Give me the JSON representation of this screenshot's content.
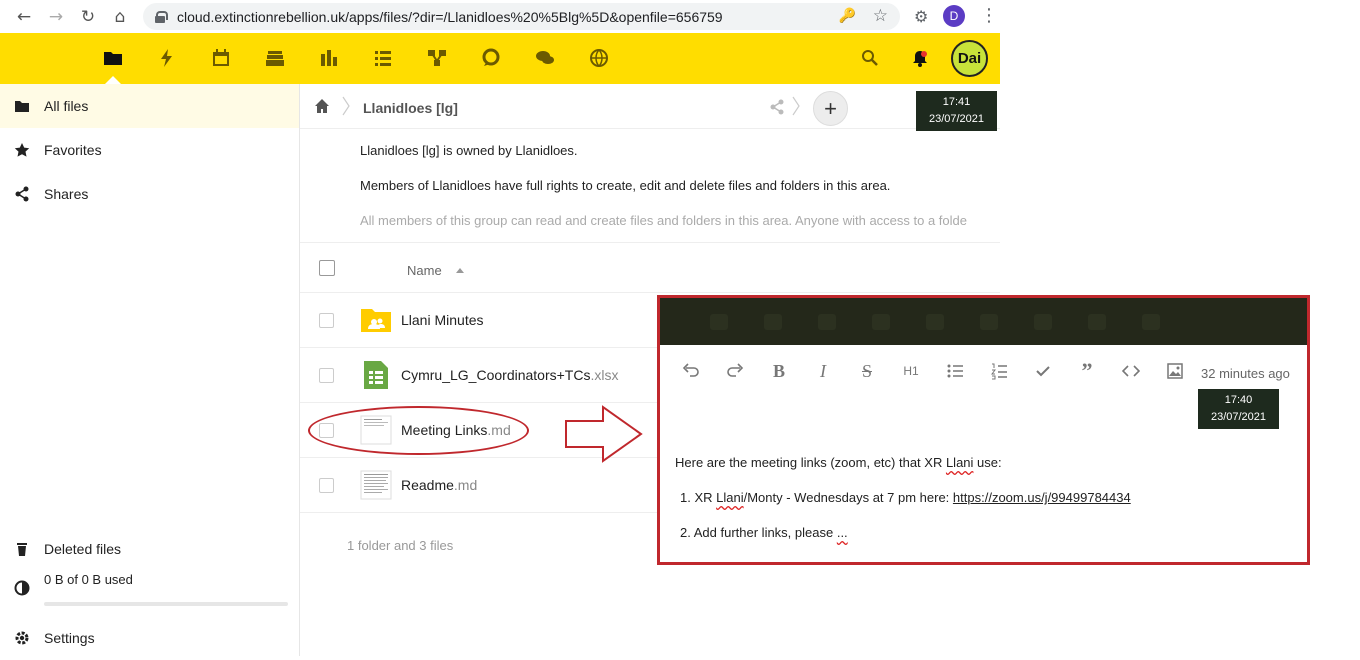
{
  "browser": {
    "url": "cloud.extinctionrebellion.uk/apps/files/?dir=/Llanidloes%20%5Blg%5D&openfile=656759",
    "profile_initial": "D"
  },
  "header": {
    "apps": [
      "files-icon",
      "activity-icon",
      "calendar-icon",
      "deck-icon",
      "analytics-icon",
      "tasks-icon",
      "circles-icon",
      "talk-icon",
      "chat-icon",
      "globe-icon"
    ],
    "avatar_text": "Dai",
    "accent": "#ffdd00"
  },
  "clock_top": {
    "time": "17:41",
    "date": "23/07/2021"
  },
  "sidebar": {
    "items": [
      {
        "label": "All files"
      },
      {
        "label": "Favorites"
      },
      {
        "label": "Shares"
      }
    ],
    "deleted_label": "Deleted files",
    "quota_label": "0 B of 0 B used",
    "settings_label": "Settings"
  },
  "breadcrumb": {
    "folder": "Llanidloes [lg]"
  },
  "description": {
    "line1": "Llanidloes [lg] is owned by Llanidloes.",
    "line2": "Members of Llanidloes have full rights to create, edit and delete files and folders in this area.",
    "line3": "All members of this group can read and create files and folders in this area. Anyone with access to a folde"
  },
  "file_list": {
    "name_header": "Name",
    "rows": [
      {
        "base": "Llani Minutes",
        "ext": ""
      },
      {
        "base": "Cymru_LG_Coordinators+TCs",
        "ext": ".xlsx"
      },
      {
        "base": "Meeting Links",
        "ext": ".md"
      },
      {
        "base": "Readme",
        "ext": ".md"
      }
    ],
    "summary": "1 folder and 3 files"
  },
  "editor": {
    "saved_status": "32 minutes ago",
    "heading_btn": "H1",
    "clock": {
      "time": "17:40",
      "date": "23/07/2021"
    },
    "intro_pre": "Here are the meeting links (zoom, etc) that XR ",
    "intro_word": "Llani",
    "intro_post": " use:",
    "item1_num": "1.",
    "item1_pre": "XR ",
    "item1_word": "Llani",
    "item1_mid": "/Monty - Wednesdays at 7 pm here: ",
    "item1_link": "https://zoom.us/j/99499784434",
    "item2_num": "2.",
    "item2_pre": "Add further links, please ",
    "item2_tail": "..."
  }
}
